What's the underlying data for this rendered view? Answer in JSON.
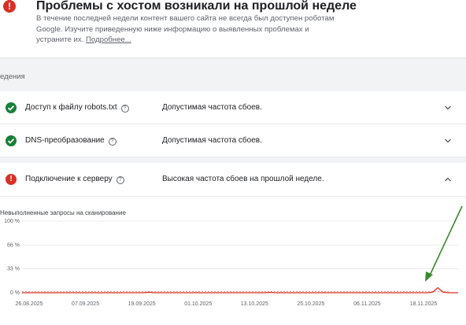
{
  "issue": {
    "title": "Проблемы с хостом возникали на прошлой неделе",
    "description": "В течение последней недели контент вашего сайта не всегда был доступен роботам Google. Изучите приведенную ниже информацию о выявленных проблемах и устраните их.",
    "more_link": "Подробнее..."
  },
  "section": {
    "label": "едения"
  },
  "rows": [
    {
      "name": "Доступ к файлу robots.txt",
      "status": "ok",
      "value": "Допустимая частота сбоев.",
      "expanded": false
    },
    {
      "name": "DNS-преобразование",
      "status": "ok",
      "value": "Допустимая частота сбоев.",
      "expanded": false
    },
    {
      "name": "Подключение к серверу",
      "status": "error",
      "value": "Высокая частота сбоев на прошлой неделе.",
      "expanded": true
    }
  ],
  "chart": {
    "title": "Невыполненные запросы на сканирование",
    "color": "#d93025"
  },
  "chart_data": {
    "type": "line",
    "title": "Невыполненные запросы на сканирование",
    "y_ticks": [
      "100 %",
      "66 %",
      "33 %",
      "0 %"
    ],
    "ylim": [
      0,
      100
    ],
    "x_ticks": [
      "26.08.2025",
      "07.09.2025",
      "19.09.2025",
      "01.10.2025",
      "13.10.2025",
      "25.10.2025",
      "06.11.2025",
      "18.11.2025"
    ],
    "x_range": [
      "2025-08-26",
      "2025-11-20"
    ],
    "grid": true,
    "threshold_dashed": true,
    "series": [
      {
        "values": [
          [
            "2025-08-26",
            0
          ],
          [
            "2025-09-19",
            0
          ],
          [
            "2025-09-20",
            0.8
          ],
          [
            "2025-09-21",
            0
          ],
          [
            "2025-10-13",
            0
          ],
          [
            "2025-10-14",
            0.6
          ],
          [
            "2025-10-15",
            0
          ],
          [
            "2025-11-14",
            0
          ],
          [
            "2025-11-15",
            1
          ],
          [
            "2025-11-16",
            7
          ],
          [
            "2025-11-17",
            1
          ],
          [
            "2025-11-18",
            0
          ],
          [
            "2025-11-20",
            0
          ]
        ]
      }
    ]
  }
}
